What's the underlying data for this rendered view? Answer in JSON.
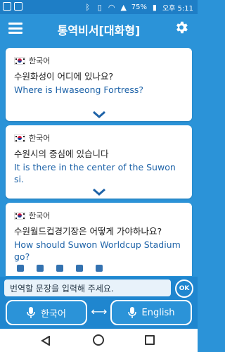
{
  "status_bar": {
    "battery": "75%",
    "time": "오후 5:11"
  },
  "app_bar": {
    "title": "통역비서[대화형]",
    "menu_icon": "menu-icon",
    "settings_icon": "gear-icon"
  },
  "cards": [
    {
      "source_lang": "한국어",
      "source_text": "수원화성이 어디에 있나요?",
      "target_text": "Where is Hwaseong Fortress?"
    },
    {
      "source_lang": "한국어",
      "source_text": "수원시의 중심에 있습니다",
      "target_text": "It is there in the center of the Suwon si."
    },
    {
      "source_lang": "한국어",
      "source_text": "수원월드컵경기장은 어떻게 가야하나요?",
      "target_text": "How should Suwon Worldcup Stadium go?"
    }
  ],
  "input": {
    "placeholder": "번역할 문장을 입력해 주세요.",
    "ok_label": "OK"
  },
  "language_buttons": {
    "left_label": "한국어",
    "right_label": "English"
  },
  "colors": {
    "primary": "#2b93d8",
    "status_bar": "#1e7ec6",
    "target_text": "#1e63a8"
  }
}
